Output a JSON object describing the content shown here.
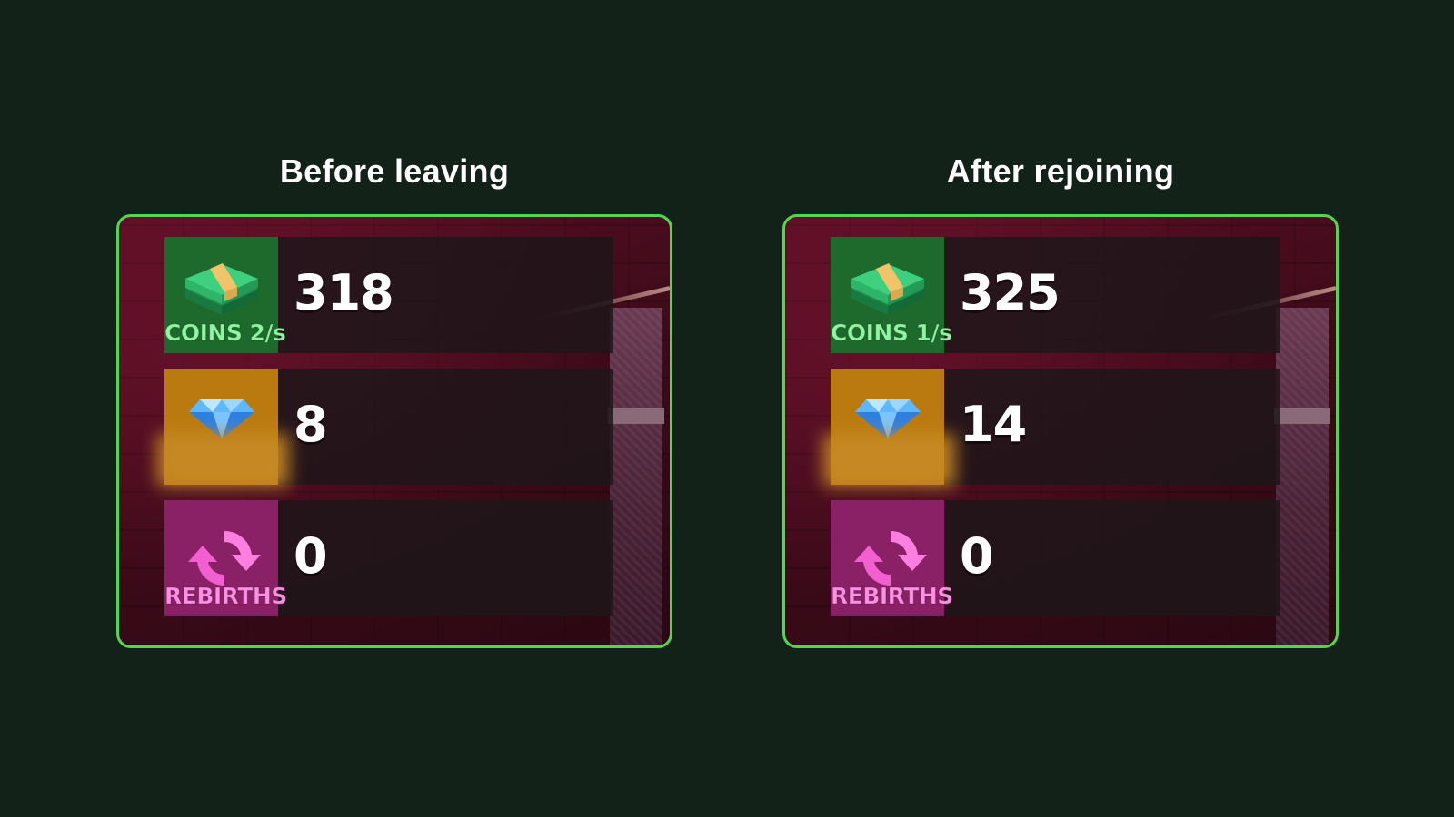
{
  "panels": [
    {
      "title": "Before leaving",
      "coins": {
        "value": "318",
        "label": "COINS 2/s",
        "icon": "cash-stack-icon"
      },
      "gems": {
        "value": "8",
        "icon": "diamond-icon"
      },
      "rebirths": {
        "value": "0",
        "label": "REBIRTHS",
        "icon": "rebirth-arrows-icon"
      }
    },
    {
      "title": "After rejoining",
      "coins": {
        "value": "325",
        "label": "COINS 1/s",
        "icon": "cash-stack-icon"
      },
      "gems": {
        "value": "14",
        "icon": "diamond-icon"
      },
      "rebirths": {
        "value": "0",
        "label": "REBIRTHS",
        "icon": "rebirth-arrows-icon"
      }
    }
  ],
  "colors": {
    "background": "#132218",
    "frame_border": "#4fd84a",
    "coins_tile": "#1e6a2c",
    "gems_tile": "#bb7a0f",
    "rebirths_tile": "#8a2066"
  }
}
